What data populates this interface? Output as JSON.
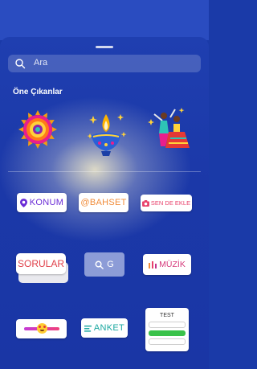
{
  "search": {
    "placeholder": "Ara"
  },
  "featured_section": {
    "title": "Öne Çıkanlar"
  },
  "stickers": {
    "location": "KONUM",
    "mention": "@BAHSET",
    "add_yours": "SEN DE EKLE",
    "questions": "SORULAR",
    "gif_search": "G",
    "music": "MÜZİK",
    "poll": "ANKET",
    "quiz": "TEST"
  },
  "colors": {
    "background": "#1a3aa8",
    "location": "#6a2bd6",
    "mention": "#f08c3a",
    "add_yours": "#e8416b",
    "questions": "#e0404a",
    "music": "#d63c7d",
    "poll": "#1aa8a0",
    "quiz_correct": "#3ac24a"
  }
}
